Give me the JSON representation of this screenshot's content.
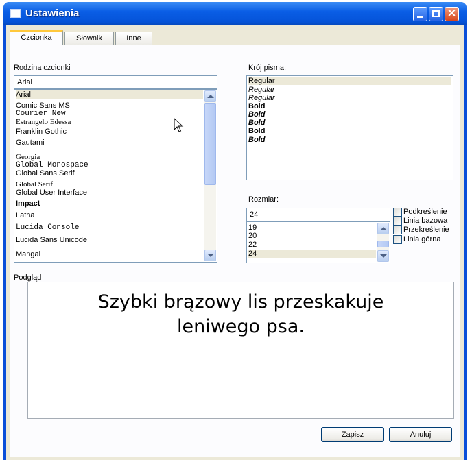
{
  "window": {
    "title": "Ustawienia",
    "controls": {
      "minimize": "minimize",
      "maximize": "maximize",
      "close": "×"
    }
  },
  "tabs": [
    {
      "label": "Czcionka",
      "active": true
    },
    {
      "label": "Słownik",
      "active": false
    },
    {
      "label": "Inne",
      "active": false
    }
  ],
  "font_family": {
    "label": "Rodzina czcionki",
    "value": "Arial",
    "items": [
      {
        "label": "Arial",
        "font": "sans-serif",
        "selected": true
      },
      {
        "label": "Comic Sans MS",
        "font": "sans-serif"
      },
      {
        "label": "Courier New",
        "font": "monospace"
      },
      {
        "label": "Estrangelo Edessa",
        "font": "serif"
      },
      {
        "label": "Franklin Gothic",
        "font": "sans-serif"
      },
      {
        "label": "Gautami",
        "font": "sans-serif"
      },
      {
        "label": "Georgia",
        "font": "serif"
      },
      {
        "label": "Global Monospace",
        "font": "monospace"
      },
      {
        "label": "Global Sans Serif",
        "font": "sans-serif"
      },
      {
        "label": "Global Serif",
        "font": "serif"
      },
      {
        "label": "Global User Interface",
        "font": "sans-serif"
      },
      {
        "label": "Impact",
        "font": "sans-serif",
        "bold": true
      },
      {
        "label": "Latha",
        "font": "sans-serif"
      },
      {
        "label": "Lucida Console",
        "font": "monospace"
      },
      {
        "label": "Lucida Sans Unicode",
        "font": "sans-serif"
      },
      {
        "label": "Mangal",
        "font": "sans-serif"
      }
    ]
  },
  "font_style": {
    "label": "Krój pisma:",
    "items": [
      {
        "label": "Regular",
        "style": "normal",
        "selected": true
      },
      {
        "label": "Regular",
        "style": "italic"
      },
      {
        "label": "Regular",
        "style": "italic"
      },
      {
        "label": "Bold",
        "style": "bold"
      },
      {
        "label": "Bold",
        "style": "bold-italic"
      },
      {
        "label": "Bold",
        "style": "bold-italic"
      },
      {
        "label": "Bold",
        "style": "bold"
      },
      {
        "label": "Bold",
        "style": "bold-italic"
      }
    ]
  },
  "font_size": {
    "label": "Rozmiar:",
    "value": "24",
    "items": [
      {
        "label": "19"
      },
      {
        "label": "20"
      },
      {
        "label": "22"
      },
      {
        "label": "24",
        "selected": true
      }
    ]
  },
  "effects": [
    {
      "label": "Podkreślenie",
      "checked": false
    },
    {
      "label": "Linia bazowa",
      "checked": false
    },
    {
      "label": "Przekreślenie",
      "checked": false
    },
    {
      "label": "Linia górna",
      "checked": false
    }
  ],
  "preview": {
    "label": "Podgląd",
    "text": "Szybki brązowy lis przeskakuje leniwego psa."
  },
  "buttons": {
    "save": "Zapisz",
    "cancel": "Anuluj"
  },
  "colors": {
    "titlebar": "#0553d8",
    "dialog_bg": "#ece9d8",
    "selection": "#ece9d8",
    "active_tab_accent": "#ffc83c"
  },
  "icons": {
    "cursor": "mouse-pointer-icon",
    "app": "window-app-icon"
  }
}
